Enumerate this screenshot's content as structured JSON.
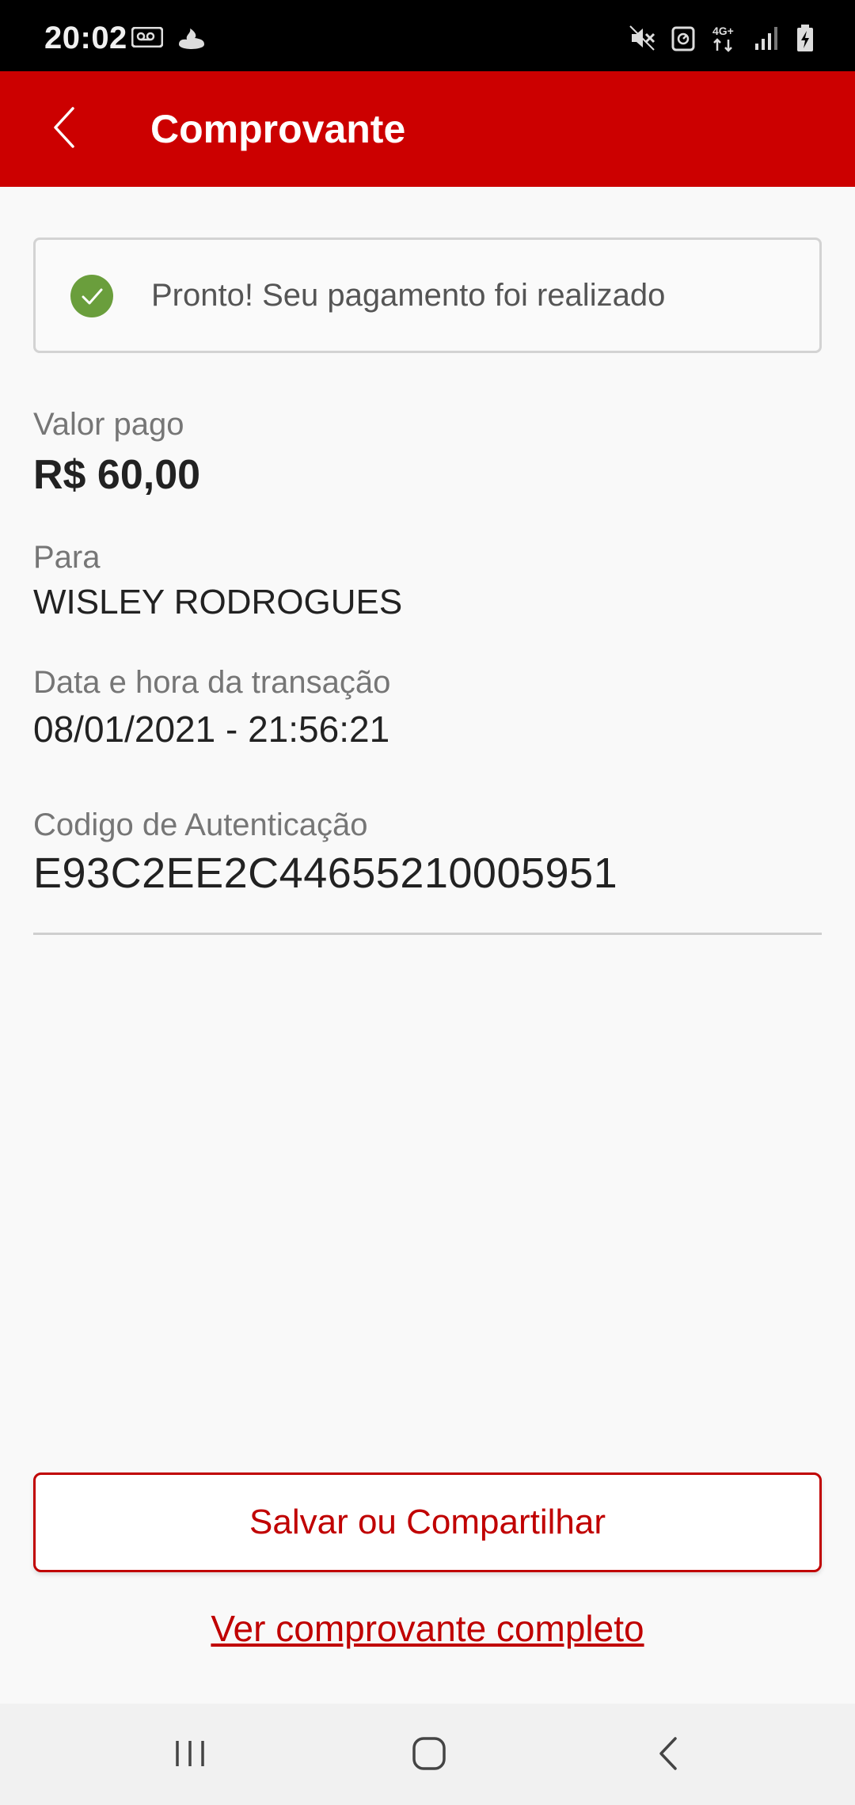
{
  "status_bar": {
    "time": "20:02",
    "left_icons": [
      "voicemail-icon",
      "santander-flame-icon"
    ],
    "right_icons": [
      "vibrate-mute-icon",
      "data-saver-icon",
      "network-4g-plus-icon",
      "signal-icon",
      "battery-charging-icon"
    ],
    "network_label": "4G+"
  },
  "app_bar": {
    "title": "Comprovante",
    "back_icon": "chevron-left-icon",
    "background_color": "#cc0000"
  },
  "success_banner": {
    "icon": "check-circle-icon",
    "icon_color": "#6a9e3c",
    "message": "Pronto! Seu pagamento foi realizado"
  },
  "details": {
    "amount_label": "Valor pago",
    "amount_value": "R$ 60,00",
    "recipient_label": "Para",
    "recipient_value": "WISLEY RODROGUES",
    "datetime_label": "Data e hora da transação",
    "datetime_value": "08/01/2021 - 21:56:21",
    "authcode_label": "Codigo de Autenticação",
    "authcode_value": "E93C2EE2C44655210005951"
  },
  "actions": {
    "save_share_label": "Salvar ou Compartilhar",
    "full_receipt_label": "Ver comprovante completo",
    "accent_color": "#c00000"
  },
  "nav_bar": {
    "icons": [
      "recent-apps-icon",
      "home-icon",
      "back-icon"
    ]
  }
}
